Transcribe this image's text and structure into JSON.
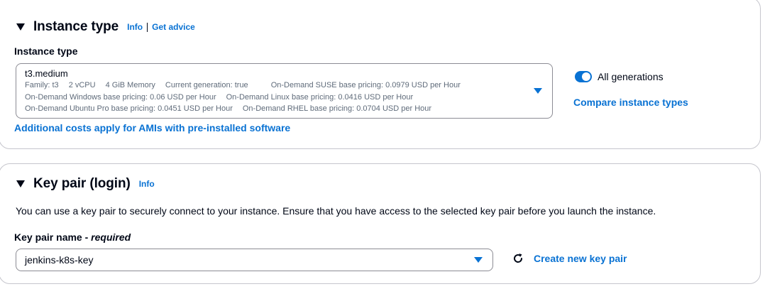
{
  "instance_section": {
    "title": "Instance type",
    "info_link": "Info",
    "advice_link": "Get advice",
    "field_label": "Instance type",
    "selected": {
      "value": "t3.medium",
      "line1": [
        "Family: t3",
        "2 vCPU",
        "4 GiB Memory",
        "Current generation: true",
        "On-Demand SUSE base pricing: 0.0979 USD per Hour"
      ],
      "line2": [
        "On-Demand Windows base pricing: 0.06 USD per Hour",
        "On-Demand Linux base pricing: 0.0416 USD per Hour"
      ],
      "line3": [
        "On-Demand Ubuntu Pro base pricing: 0.0451 USD per Hour",
        "On-Demand RHEL base pricing: 0.0704 USD per Hour"
      ]
    },
    "ami_costs_link": "Additional costs apply for AMIs with pre-installed software",
    "toggle_label": "All generations",
    "toggle_on": true,
    "compare_link": "Compare instance types"
  },
  "key_section": {
    "title": "Key pair (login)",
    "info_link": "Info",
    "description": "You can use a key pair to securely connect to your instance. Ensure that you have access to the selected key pair before you launch the instance.",
    "field_label": "Key pair name",
    "required_suffix": "required",
    "selected_value": "jenkins-k8s-key",
    "create_link": "Create new key pair"
  },
  "colors": {
    "accent": "#0972d3",
    "text": "#000716",
    "muted": "#5f6b7a",
    "border": "#8c8c94"
  },
  "icons": [
    "caret-down-icon",
    "dropdown-arrow-icon",
    "refresh-icon"
  ]
}
